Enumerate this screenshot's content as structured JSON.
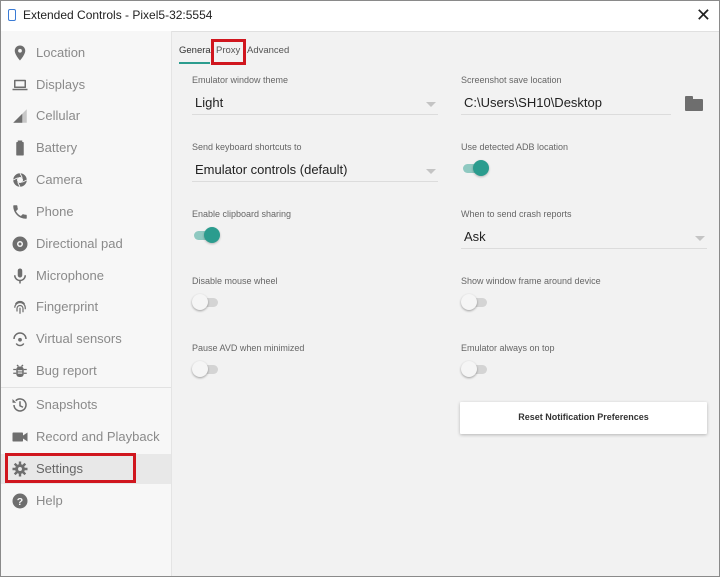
{
  "window": {
    "title": "Extended Controls - Pixel5-32:5554",
    "close_glyph": "✕"
  },
  "sidebar": {
    "items": [
      {
        "label": "Location",
        "icon": "location-pin-icon"
      },
      {
        "label": "Displays",
        "icon": "laptop-icon"
      },
      {
        "label": "Cellular",
        "icon": "signal-icon"
      },
      {
        "label": "Battery",
        "icon": "battery-icon"
      },
      {
        "label": "Camera",
        "icon": "camera-icon"
      },
      {
        "label": "Phone",
        "icon": "phone-icon"
      },
      {
        "label": "Directional pad",
        "icon": "dpad-icon"
      },
      {
        "label": "Microphone",
        "icon": "microphone-icon"
      },
      {
        "label": "Fingerprint",
        "icon": "fingerprint-icon"
      },
      {
        "label": "Virtual sensors",
        "icon": "virtual-sensors-icon"
      },
      {
        "label": "Bug report",
        "icon": "bug-icon"
      },
      {
        "label": "Snapshots",
        "icon": "history-icon"
      },
      {
        "label": "Record and Playback",
        "icon": "video-camera-icon"
      },
      {
        "label": "Settings",
        "icon": "gear-icon",
        "active": true
      },
      {
        "label": "Help",
        "icon": "help-icon"
      }
    ]
  },
  "tabs": [
    {
      "label": "General",
      "active": true
    },
    {
      "label": "Proxy"
    },
    {
      "label": "Advanced"
    }
  ],
  "settings": {
    "theme": {
      "label": "Emulator window theme",
      "value": "Light"
    },
    "keyboard": {
      "label": "Send keyboard shortcuts to",
      "value": "Emulator controls (default)"
    },
    "clipboard": {
      "label": "Enable clipboard sharing",
      "on": true
    },
    "mouse_wheel": {
      "label": "Disable mouse wheel",
      "on": false
    },
    "pause_avd": {
      "label": "Pause AVD when minimized",
      "on": false
    },
    "screenshot": {
      "label": "Screenshot save location",
      "value": "C:\\Users\\SH10\\Desktop"
    },
    "adb": {
      "label": "Use detected ADB location",
      "on": true
    },
    "crash": {
      "label": "When to send crash reports",
      "value": "Ask"
    },
    "window_frame": {
      "label": "Show window frame around device",
      "on": false
    },
    "always_on_top": {
      "label": "Emulator always on top",
      "on": false
    },
    "reset_button": "Reset Notification Preferences"
  },
  "colors": {
    "accent": "#2b9c8e",
    "highlight": "#d0161e"
  }
}
